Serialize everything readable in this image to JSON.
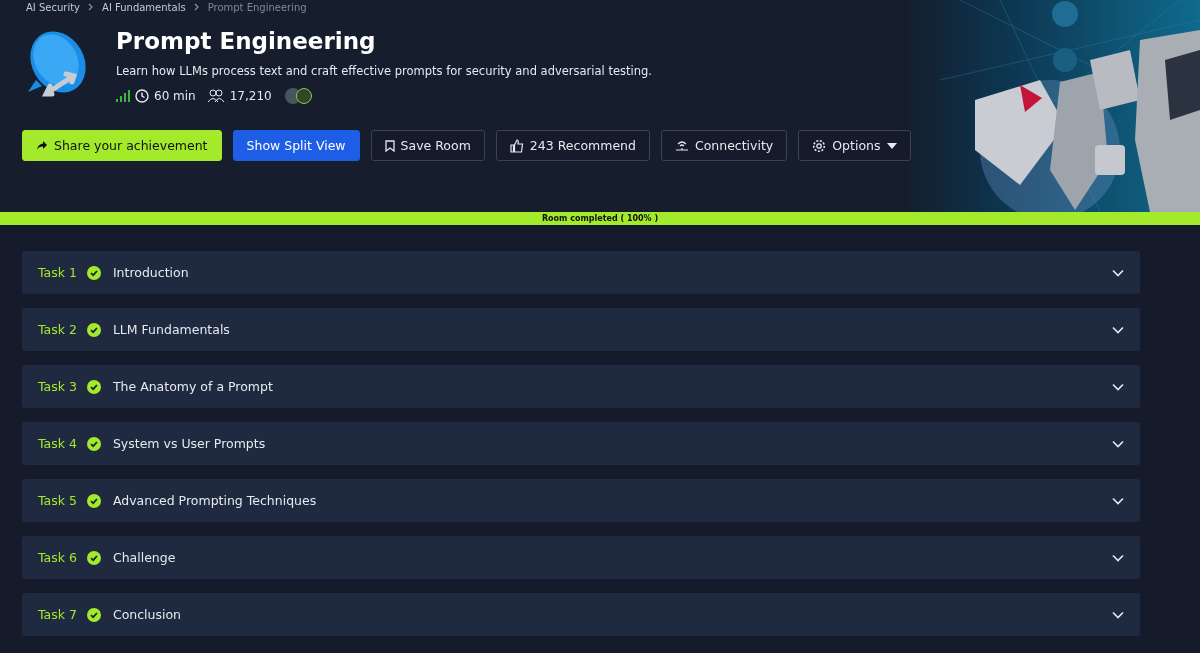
{
  "breadcrumb": [
    "AI Security",
    "AI Fundamentals",
    "Prompt Engineering"
  ],
  "room": {
    "title": "Prompt Engineering",
    "description": "Learn how LLMs process text and craft effective prompts for security and adversarial testing.",
    "duration": "60 min",
    "users": "17,210"
  },
  "actions": [
    {
      "kind": "share",
      "label": "Share your achievement"
    },
    {
      "kind": "split",
      "label": "Show Split View"
    },
    {
      "kind": "save",
      "label": "Save Room"
    },
    {
      "kind": "recommend",
      "label": "243 Recommend"
    },
    {
      "kind": "connectivity",
      "label": "Connectivity"
    },
    {
      "kind": "options",
      "label": "Options"
    }
  ],
  "progress": {
    "label": "Room completed ( 100% )",
    "level": 1
  },
  "tasks": [
    {
      "number": "Task 1",
      "title": "Introduction",
      "completed": true,
      "expanded": false
    },
    {
      "number": "Task 2",
      "title": "LLM Fundamentals",
      "completed": true,
      "expanded": false
    },
    {
      "number": "Task 3",
      "title": "The Anatomy of a Prompt",
      "completed": true,
      "expanded": false
    },
    {
      "number": "Task 4",
      "title": "System vs User Prompts",
      "completed": true,
      "expanded": false
    },
    {
      "number": "Task 5",
      "title": "Advanced Prompting Techniques",
      "completed": true,
      "expanded": false
    },
    {
      "number": "Task 6",
      "title": "Challenge",
      "completed": true,
      "expanded": false
    },
    {
      "number": "Task 7",
      "title": "Conclusion",
      "completed": true,
      "expanded": false
    }
  ]
}
